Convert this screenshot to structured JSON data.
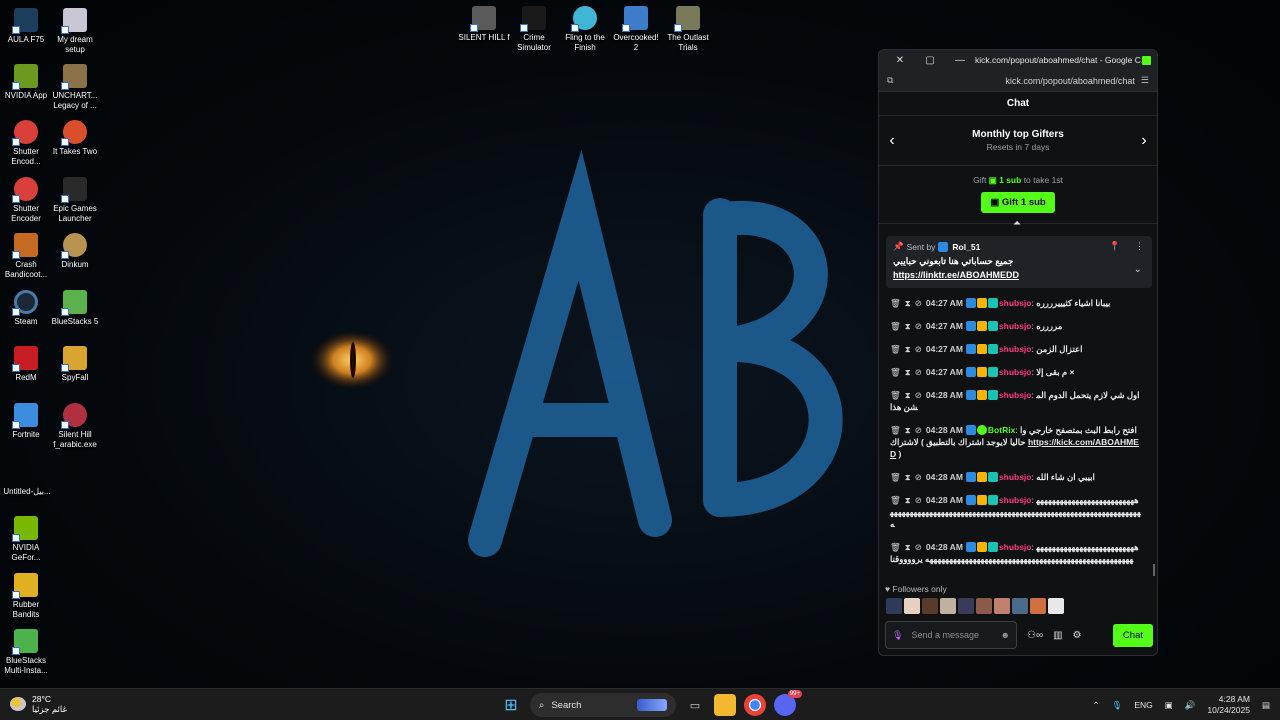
{
  "desktop": {
    "icons": [
      {
        "label": "AULA F75",
        "color": "#1d3d5c"
      },
      {
        "label": "My dream setup",
        "color": "#c9c6d6"
      },
      {
        "label": "NVIDIA App",
        "color": "#6a9a1f"
      },
      {
        "label": "UNCHART... Legacy of ...",
        "color": "#8b7248"
      },
      {
        "label": "Shutter Encod...",
        "color": "#d9403a"
      },
      {
        "label": "It Takes Two",
        "color": "#d94f2c"
      },
      {
        "label": "Shutter Encoder",
        "color": "#d9403a"
      },
      {
        "label": "Epic Games Launcher",
        "color": "#2a2a2a"
      },
      {
        "label": "Crash Bandicoot...",
        "color": "#c46a22"
      },
      {
        "label": "Dinkum",
        "color": "#b89352"
      },
      {
        "label": "Steam",
        "color": "#1b2838"
      },
      {
        "label": "BlueStacks 5",
        "color": "#5bb24c"
      },
      {
        "label": "RedM",
        "color": "#c81d25"
      },
      {
        "label": "SpyFall",
        "color": "#d8a630"
      },
      {
        "label": "Fortnite",
        "color": "#3c8ce0"
      },
      {
        "label": "Silent Hill f_arabic.exe",
        "color": "#b03040"
      },
      {
        "label": "Untitled-بيل...",
        "color": "#0a0a0a"
      },
      {
        "label": "NVIDIA GeFor...",
        "color": "#76b900"
      },
      {
        "label": "Rubber Bandits",
        "color": "#e0b020"
      },
      {
        "label": "BlueStacks Multi-Insta...",
        "color": "#4cb34c"
      },
      {
        "label": "SILENT HILL f",
        "color": "#5a5a5a"
      },
      {
        "label": "Crime Simulator",
        "color": "#1a1a1a"
      },
      {
        "label": "Fling to the Finish",
        "color": "#3fb6d6"
      },
      {
        "label": "Overcooked! 2",
        "color": "#3c7cc8"
      },
      {
        "label": "The Outlast Trials",
        "color": "#7a7a5a"
      }
    ]
  },
  "wallpaper": {
    "letters": "AB"
  },
  "window": {
    "title": "kick.com/popout/aboahmed/chat - Google C...",
    "url": "kick.com/popout/aboahmed/chat",
    "close_icon": "✕",
    "restore_icon": "▢",
    "minimize_icon": "—"
  },
  "chat": {
    "header": "Chat",
    "gifters": {
      "title": "Monthly top Gifters",
      "subtitle": "Resets in 7 days"
    },
    "gift": {
      "prefix": "Gift",
      "highlight": "1 sub",
      "suffix": "to take 1st",
      "button": "Gift 1 sub"
    },
    "pinned": {
      "sent_by": "Sent by",
      "user": "Rol_51",
      "message": "جميع حساباتي هنا تابعوني حبايبي",
      "link": "https://linktr.ee/ABOAHMEDD"
    },
    "messages": [
      {
        "time": "04:27 AM",
        "user": "shubsjo",
        "type": "user",
        "text": "بيبانا اشياء كثيييرررره"
      },
      {
        "time": "04:27 AM",
        "user": "shubsjo",
        "type": "user",
        "text": "مرررره"
      },
      {
        "time": "04:27 AM",
        "user": "shubsjo",
        "type": "user",
        "text": "اعتزال الزمن"
      },
      {
        "time": "04:27 AM",
        "user": "shubsjo",
        "type": "user",
        "text": "م بقى إلا ×"
      },
      {
        "time": "04:28 AM",
        "user": "shubsjo",
        "type": "user",
        "text": "اول شي لازم يتحمل الدوم المشن هذا"
      },
      {
        "time": "04:28 AM",
        "user": "BotRix",
        "type": "bot",
        "text": "افتح رابط البث بمتصفح خارجي والاشتراك ( حاليا لايوجد اشتراك بالتطبيق",
        "link": "https://kick.com/ABOAHMED",
        "tail": ")"
      },
      {
        "time": "04:28 AM",
        "user": "shubsjo",
        "type": "user",
        "text": "ابيبي ان شاء الله"
      },
      {
        "time": "04:28 AM",
        "user": "shubsjo",
        "type": "user",
        "text": "ههههههههههههههههههههههههههههههههههههههههههههههههههههههههههههههههههههههههههههههههههههههههههه"
      },
      {
        "time": "04:28 AM",
        "user": "shubsjo",
        "type": "user",
        "text": "ههههههههههههههههههههههههههههههههههههههههههههههههههههههههههههههههههههههههههههههه يرووووقنا"
      }
    ],
    "followers_only": "Followers only",
    "avatar_colors": [
      "#2d3a5a",
      "#e8d0c0",
      "#5a3a2a",
      "#c0b0a0",
      "#3a3a5a",
      "#8a5a4a",
      "#c08070",
      "#4a6a8a",
      "#d07040",
      "#e8e8e8"
    ],
    "input": {
      "placeholder": "Send a message"
    },
    "chat_button": "Chat"
  },
  "taskbar": {
    "weather": {
      "temp": "28°C",
      "desc": "غائم جزئيا"
    },
    "search": "Search",
    "language": "ENG",
    "time": "4:28 AM",
    "date": "10/24/2025",
    "discord_badge": "99+"
  }
}
